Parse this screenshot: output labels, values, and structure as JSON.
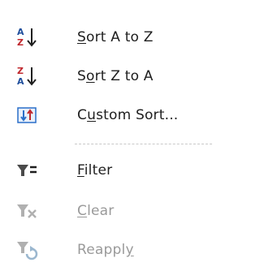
{
  "menu": {
    "items": [
      {
        "icon": "sort-a-to-z-icon",
        "pre": "",
        "key": "S",
        "post": "ort A to Z",
        "disabled": false
      },
      {
        "icon": "sort-z-to-a-icon",
        "pre": "S",
        "key": "o",
        "post": "rt Z to A",
        "disabled": false
      },
      {
        "icon": "custom-sort-icon",
        "pre": "C",
        "key": "u",
        "post": "stom Sort...",
        "disabled": false
      },
      {
        "icon": "filter-icon",
        "pre": "",
        "key": "F",
        "post": "ilter",
        "disabled": false
      },
      {
        "icon": "clear-filter-icon",
        "pre": "",
        "key": "C",
        "post": "lear",
        "disabled": true
      },
      {
        "icon": "reapply-filter-icon",
        "pre": "Reappl",
        "key": "y",
        "post": "",
        "disabled": true
      }
    ]
  },
  "colors": {
    "text": "#1e1e1e",
    "disabled_text": "#9a9a9a",
    "sort_letter_blue": "#1f4e9c",
    "sort_letter_red": "#c0282e",
    "custom_sort_blue": "#2a6fc9",
    "separator": "#c8c8c8"
  }
}
